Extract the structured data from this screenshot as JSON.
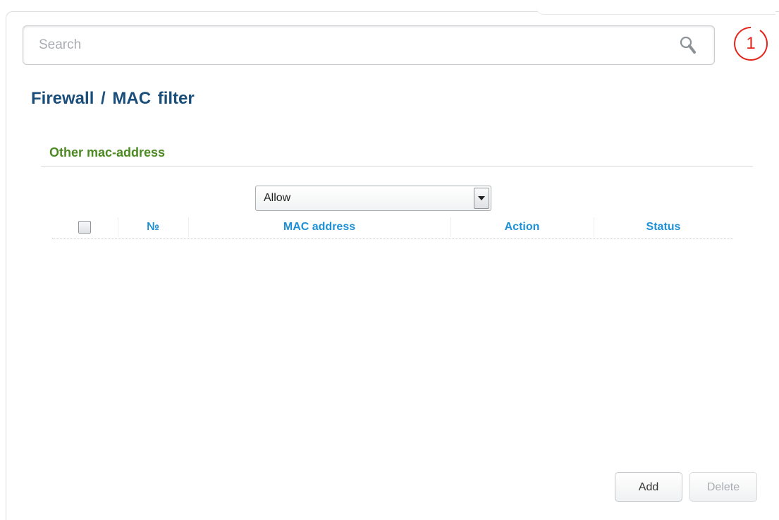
{
  "search": {
    "placeholder": "Search"
  },
  "notification": {
    "count": "1",
    "color": "#e3241b"
  },
  "breadcrumb": {
    "text": "Firewall /  MAC filter"
  },
  "section": {
    "title": "Other mac-address"
  },
  "filter_select": {
    "selected": "Allow"
  },
  "table": {
    "columns": [
      "№",
      "MAC address",
      "Action",
      "Status"
    ],
    "rows": []
  },
  "buttons": {
    "add": "Add",
    "delete": "Delete"
  },
  "colors": {
    "title": "#1a4e7a",
    "section": "#4b8a22",
    "header": "#1e90d6"
  }
}
